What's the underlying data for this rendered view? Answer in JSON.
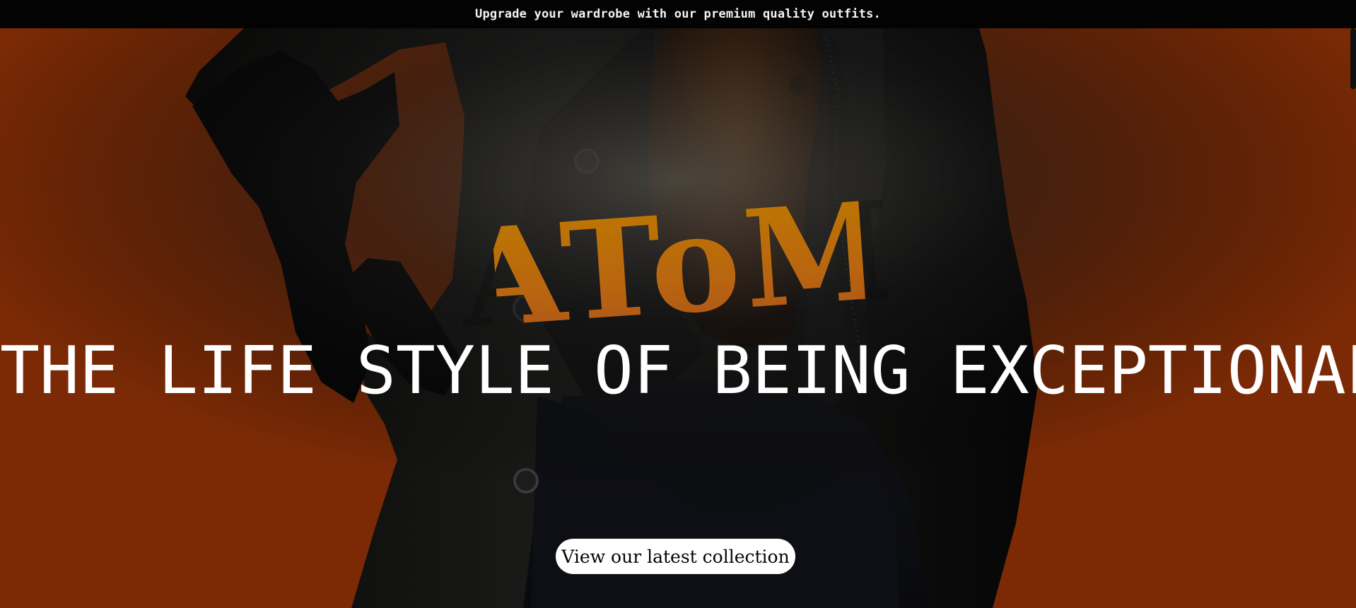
{
  "announcement": {
    "text": "Upgrade your wardrobe with our premium quality outfits."
  },
  "hero": {
    "brand": "AToM",
    "heading": "THE LIFE STYLE OF BEING EXCEPTIONAL",
    "button_label": "View our latest collection",
    "background_color": "#7b2a05",
    "brand_gradient": [
      "#df8f00",
      "#cb6120"
    ]
  },
  "icons": {
    "hero_image": "model-outfit-image",
    "scroll_indicator": "scrollbar-thumb"
  }
}
